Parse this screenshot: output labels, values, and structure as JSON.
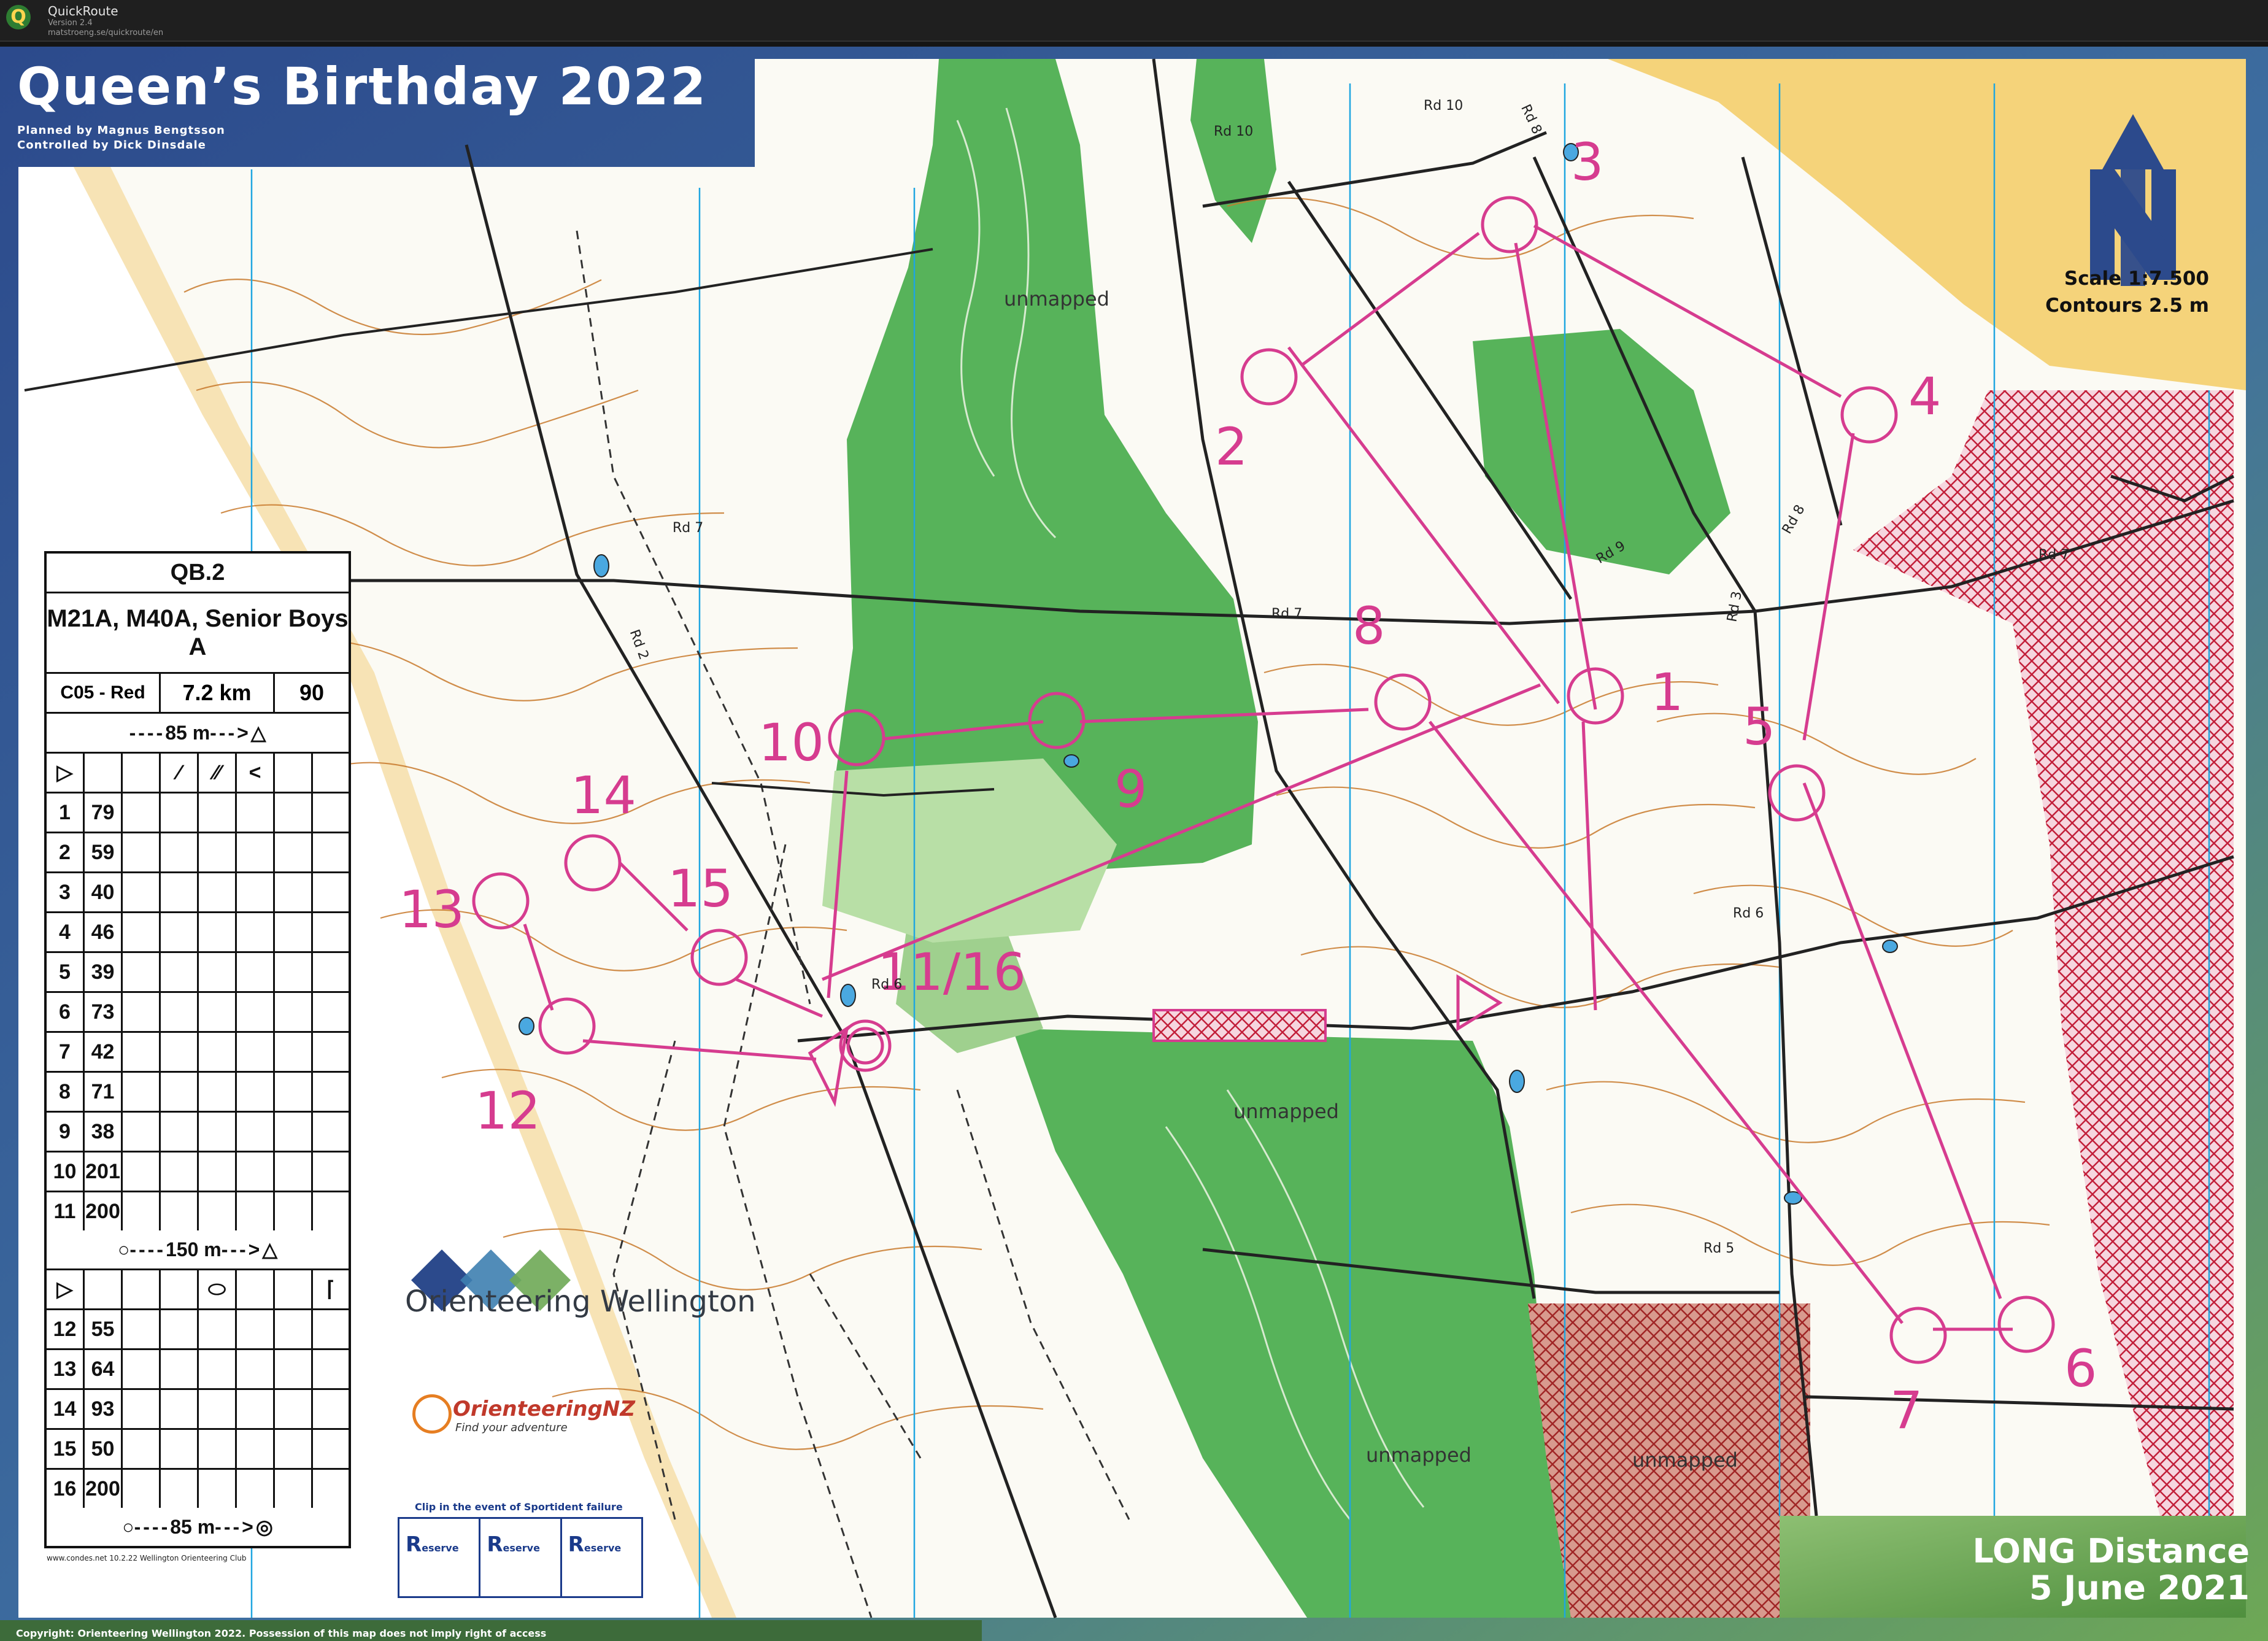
{
  "app": {
    "name": "QuickRoute",
    "version": "Version 2.4",
    "url": "matstroeng.se/quickroute/en"
  },
  "map": {
    "title": "Queen’s Birthday 2022",
    "planner": "Planned by Magnus Bengtsson",
    "controller": "Controlled by Dick Dinsdale",
    "scale": "Scale 1:7.500",
    "contours": "Contours 2.5 m",
    "event_type": "LONG Distance",
    "event_date": "5 June 2021",
    "copyright": "Copyright: Orienteering Wellington 2022. Possession of this map does not imply right of access",
    "club": "Orienteering Wellington",
    "federation": "OrienteeringNZ",
    "federation_tagline": "Find your adventure",
    "reserve_caption": "Clip in the event of Sportident failure",
    "reserve_labels": [
      "eserve",
      "eserve",
      "eserve"
    ],
    "unmapped_label": "unmapped",
    "roads": [
      "Rd 10",
      "Rd 10",
      "Rd 8",
      "Rd 7",
      "Rd 7",
      "Rd 2",
      "Rd 9",
      "Rd 8",
      "Rd 3",
      "Rd 6",
      "Rd 6",
      "Rd 5",
      "Rd 7"
    ],
    "colors": {
      "brand_blue": "#2c4a8c",
      "brand_green": "#6ea855",
      "course_magenta": "#d63c8f",
      "vegetation_green": "#57b35a",
      "contour_brown": "#c8792c",
      "out_of_bounds": "#c21f3a"
    },
    "controls": [
      {
        "label": "1"
      },
      {
        "label": "2"
      },
      {
        "label": "3"
      },
      {
        "label": "4"
      },
      {
        "label": "5"
      },
      {
        "label": "6"
      },
      {
        "label": "7"
      },
      {
        "label": "8"
      },
      {
        "label": "9"
      },
      {
        "label": "10"
      },
      {
        "label": "11/16"
      },
      {
        "label": "12"
      },
      {
        "label": "13"
      },
      {
        "label": "14"
      },
      {
        "label": "15"
      }
    ],
    "north_arrow": "north-arrow-icon"
  },
  "description_sheet": {
    "event_code": "QB.2",
    "classes": "M21A, M40A, Senior Boys A",
    "course": "C05 - Red",
    "length": "7.2 km",
    "climb": "90",
    "start_tape": "85 m",
    "mid_tape": "150 m",
    "finish_tape": "85 m",
    "footer": "www.condes.net 10.2.22 Wellington Orienteering Club",
    "rows": [
      {
        "n": "1",
        "code": "79"
      },
      {
        "n": "2",
        "code": "59"
      },
      {
        "n": "3",
        "code": "40"
      },
      {
        "n": "4",
        "code": "46"
      },
      {
        "n": "5",
        "code": "39"
      },
      {
        "n": "6",
        "code": "73"
      },
      {
        "n": "7",
        "code": "42"
      },
      {
        "n": "8",
        "code": "71"
      },
      {
        "n": "9",
        "code": "38"
      },
      {
        "n": "10",
        "code": "201"
      },
      {
        "n": "11",
        "code": "200"
      }
    ],
    "rows2": [
      {
        "n": "12",
        "code": "55"
      },
      {
        "n": "13",
        "code": "64"
      },
      {
        "n": "14",
        "code": "93"
      },
      {
        "n": "15",
        "code": "50"
      },
      {
        "n": "16",
        "code": "200"
      }
    ]
  }
}
